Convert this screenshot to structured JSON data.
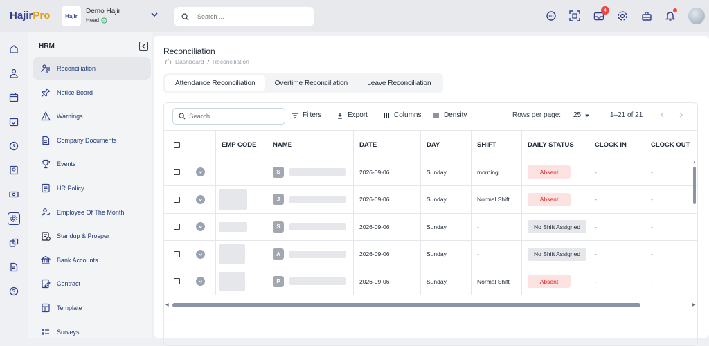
{
  "app": {
    "logo_a": "Hajir",
    "logo_b": "Pro"
  },
  "org": {
    "logo_text": "Hajir",
    "name": "Demo Hajir",
    "role": "Head"
  },
  "search": {
    "placeholder": "Search ..."
  },
  "topbar": {
    "notifications_count": "4",
    "icons": [
      "chat-icon",
      "qr-scan-icon",
      "inbox-icon",
      "gear-icon",
      "briefcase-icon",
      "bell-icon"
    ]
  },
  "rail": {
    "icons": [
      "home-icon",
      "people-icon",
      "calendar-icon",
      "calendar-check-icon",
      "clock-icon",
      "report-icon",
      "money-icon",
      "hrm-icon",
      "assets-icon",
      "document-icon",
      "help-icon"
    ]
  },
  "sidebar": {
    "section": "HRM",
    "items": [
      {
        "label": "Reconciliation",
        "icon": "reconciliation-icon",
        "active": true
      },
      {
        "label": "Notice Board",
        "icon": "pin-icon"
      },
      {
        "label": "Warnings",
        "icon": "warning-icon"
      },
      {
        "label": "Company Documents",
        "icon": "document-icon"
      },
      {
        "label": "Events",
        "icon": "trophy-icon"
      },
      {
        "label": "HR Policy",
        "icon": "policy-icon"
      },
      {
        "label": "Employee Of The Month",
        "icon": "employee-icon"
      },
      {
        "label": "Standup & Prosper",
        "icon": "standup-icon"
      },
      {
        "label": "Bank Accounts",
        "icon": "bank-icon"
      },
      {
        "label": "Contract",
        "icon": "contract-icon"
      },
      {
        "label": "Template",
        "icon": "template-icon"
      },
      {
        "label": "Surveys",
        "icon": "survey-icon"
      }
    ]
  },
  "page": {
    "title": "Reconciliation",
    "breadcrumb": [
      "Dashboard",
      "Reconciliation"
    ],
    "tabs": [
      "Attendance Reconciliation",
      "Overtime Reconciliation",
      "Leave Reconciliation"
    ]
  },
  "grid": {
    "search_placeholder": "Search...",
    "toolbar": {
      "filters": "Filters",
      "export": "Export",
      "columns": "Columns",
      "density": "Density"
    },
    "rows_per_page_label": "Rows per page:",
    "rows_per_page_value": "25",
    "pagination": "1–21 of 21",
    "columns": [
      "EMP CODE",
      "NAME",
      "DATE",
      "DAY",
      "SHIFT",
      "DAILY STATUS",
      "CLOCK IN",
      "CLOCK OUT"
    ],
    "rows": [
      {
        "initial": "S",
        "date": "2026-09-06",
        "day": "Sunday",
        "shift": "morning",
        "status": "Absent",
        "status_type": "absent",
        "clock_in": "-",
        "clock_out": "-"
      },
      {
        "initial": "J",
        "date": "2026-09-06",
        "day": "Sunday",
        "shift": "Normal Shift",
        "status": "Absent",
        "status_type": "absent",
        "clock_in": "-",
        "clock_out": "-"
      },
      {
        "initial": "S",
        "date": "2026-09-06",
        "day": "Sunday",
        "shift": "-",
        "status": "No Shift Assigned",
        "status_type": "noshift",
        "clock_in": "-",
        "clock_out": "-"
      },
      {
        "initial": "A",
        "date": "2026-09-06",
        "day": "Sunday",
        "shift": "-",
        "status": "No Shift Assigned",
        "status_type": "noshift",
        "clock_in": "-",
        "clock_out": "-"
      },
      {
        "initial": "P",
        "date": "2026-09-06",
        "day": "Sunday",
        "shift": "Normal Shift",
        "status": "Absent",
        "status_type": "absent",
        "clock_in": "-",
        "clock_out": "-"
      }
    ]
  }
}
